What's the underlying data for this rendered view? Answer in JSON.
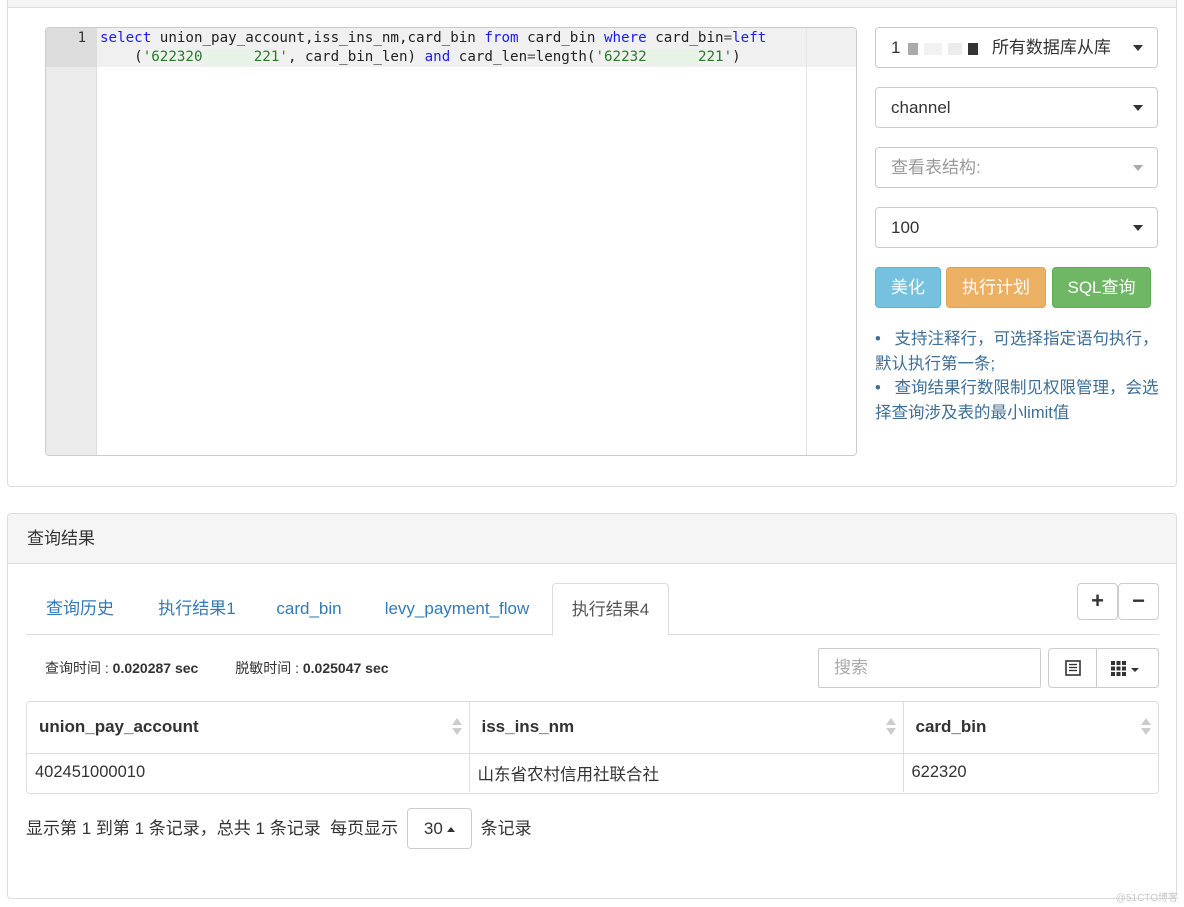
{
  "editor": {
    "line_number": "1",
    "code": {
      "kw_select": "select",
      "cols": " union_pay_account,iss_ins_nm,card_bin ",
      "kw_from": "from",
      "table": " card_bin ",
      "kw_where": "where",
      "cond1": " card_bin",
      "eq1": "=",
      "kw_left": "left",
      "indent": "    (",
      "str1_start": "'622320",
      "str1_redacted": "••••••",
      "str1_end": "221'",
      "mid": ", card_bin_len) ",
      "kw_and": "and",
      "cond2": " card_len",
      "eq2": "=",
      "fn_length": "length(",
      "str2_start": "'62232",
      "str2_redacted": "••••••",
      "str2_end": "221'",
      "close": ")"
    }
  },
  "side": {
    "db_select": {
      "prefix": "1",
      "label": "所有数据库从库"
    },
    "schema_select": {
      "value": "channel"
    },
    "table_select": {
      "placeholder": "查看表结构:"
    },
    "limit_select": {
      "value": "100"
    },
    "buttons": {
      "beautify": "美化",
      "explain": "执行计划",
      "query": "SQL查询"
    },
    "notes": [
      "•   支持注释行，可选择指定语句执行，默认执行第一条;",
      "•   查询结果行数限制见权限管理，会选择查询涉及表的最小limit值"
    ]
  },
  "results": {
    "heading": "查询结果",
    "tabs": [
      {
        "label": "查询历史",
        "active": false
      },
      {
        "label": "执行结果1",
        "active": false
      },
      {
        "label": "card_bin",
        "active": false
      },
      {
        "label": "levy_payment_flow",
        "active": false
      },
      {
        "label": "执行结果4",
        "active": true
      }
    ],
    "add_tab": "+",
    "remove_tab": "−",
    "timing": {
      "query_label": "查询时间 : ",
      "query_value": "0.020287 sec",
      "mask_label": "脱敏时间 : ",
      "mask_value": "0.025047 sec"
    },
    "search_placeholder": "搜索",
    "table": {
      "columns": [
        "union_pay_account",
        "iss_ins_nm",
        "card_bin"
      ],
      "rows": [
        [
          "402451000010",
          "山东省农村信用社联合社",
          "622320"
        ]
      ]
    },
    "pagination": {
      "summary": "显示第 1 到第 1 条记录，总共 1 条记录",
      "per_page_label": "每页显示",
      "per_page_value": "30",
      "suffix": "条记录"
    }
  },
  "watermark": "@51CTO博客"
}
